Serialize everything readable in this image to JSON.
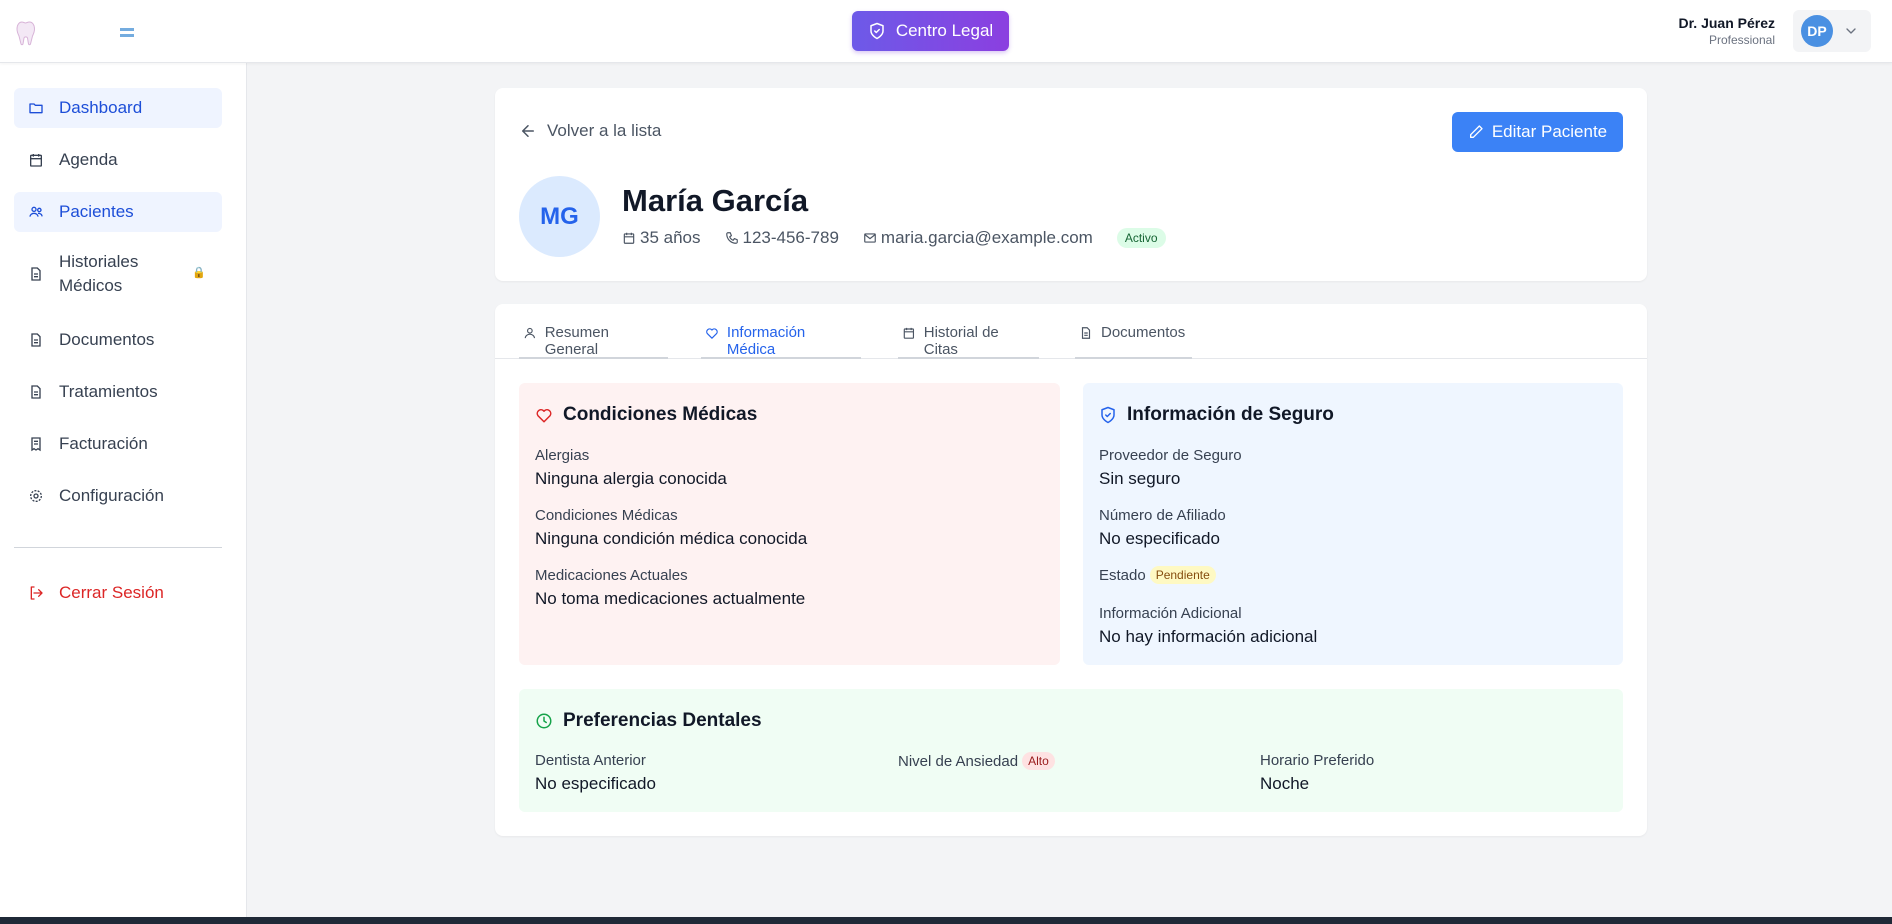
{
  "header": {
    "legal_button": "Centro Legal",
    "user_name": "Dr. Juan Pérez",
    "user_role": "Professional",
    "user_initials": "DP"
  },
  "sidebar": {
    "items": [
      {
        "label": "Dashboard",
        "icon": "folder-icon"
      },
      {
        "label": "Agenda",
        "icon": "calendar-icon"
      },
      {
        "label": "Pacientes",
        "icon": "users-icon"
      },
      {
        "label": "Historiales Médicos",
        "icon": "file-icon",
        "lock": "🔒"
      },
      {
        "label": "Documentos",
        "icon": "document-icon"
      },
      {
        "label": "Tratamientos",
        "icon": "document-icon"
      },
      {
        "label": "Facturación",
        "icon": "receipt-icon"
      },
      {
        "label": "Configuración",
        "icon": "gear-icon"
      }
    ],
    "logout": "Cerrar Sesión"
  },
  "patient": {
    "back_label": "Volver a la lista",
    "edit_label": "Editar Paciente",
    "initials": "MG",
    "name": "María García",
    "age": "35 años",
    "phone": "123-456-789",
    "email": "maria.garcia@example.com",
    "status": "Activo"
  },
  "tabs": [
    {
      "label": "Resumen General",
      "icon": "user-icon"
    },
    {
      "label": "Información Médica",
      "icon": "heart-icon",
      "active": true
    },
    {
      "label": "Historial de Citas",
      "icon": "calendar-icon"
    },
    {
      "label": "Documentos",
      "icon": "document-icon"
    }
  ],
  "medical": {
    "title": "Condiciones Médicas",
    "allergies_label": "Alergias",
    "allergies_value": "Ninguna alergia conocida",
    "conditions_label": "Condiciones Médicas",
    "conditions_value": "Ninguna condición médica conocida",
    "medications_label": "Medicaciones Actuales",
    "medications_value": "No toma medicaciones actualmente"
  },
  "insurance": {
    "title": "Información de Seguro",
    "provider_label": "Proveedor de Seguro",
    "provider_value": "Sin seguro",
    "member_label": "Número de Afiliado",
    "member_value": "No especificado",
    "status_label": "Estado",
    "status_value": "Pendiente",
    "extra_label": "Información Adicional",
    "extra_value": "No hay información adicional"
  },
  "preferences": {
    "title": "Preferencias Dentales",
    "dentist_label": "Dentista Anterior",
    "dentist_value": "No especificado",
    "anxiety_label": "Nivel de Ansiedad",
    "anxiety_value": "Alto",
    "schedule_label": "Horario Preferido",
    "schedule_value": "Noche"
  },
  "colors": {
    "primary": "#3b82f6",
    "legal_gradient_start": "#6d5ae8",
    "legal_gradient_end": "#8b3fe0",
    "logout": "#dc2626",
    "medical_panel": "#fef2f2",
    "insurance_panel": "#eff6ff",
    "preferences_panel": "#f0fdf4"
  }
}
